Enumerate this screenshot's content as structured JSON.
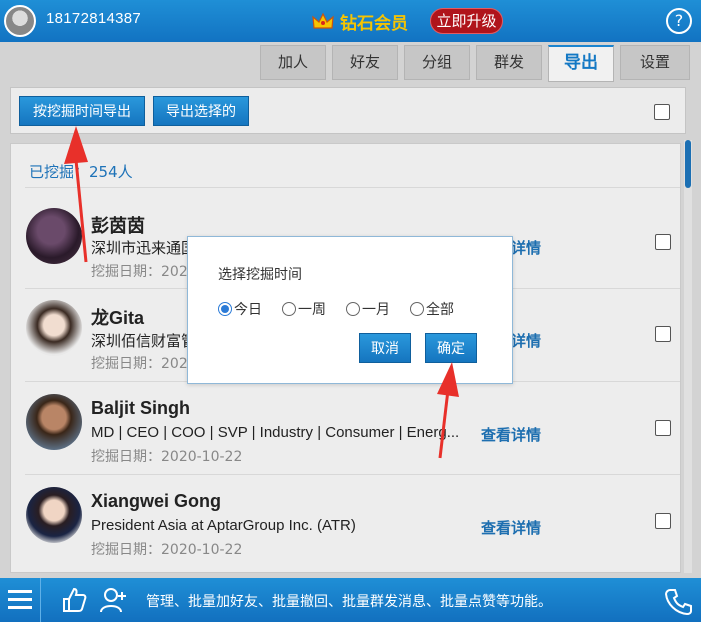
{
  "header": {
    "phone": "18172814387",
    "vip_label": "钻石会员",
    "upgrade_label": "立即升级",
    "help_label": "?"
  },
  "tabs": [
    {
      "label": "加人",
      "active": false
    },
    {
      "label": "好友",
      "active": false
    },
    {
      "label": "分组",
      "active": false
    },
    {
      "label": "群发",
      "active": false
    },
    {
      "label": "导出",
      "active": true
    },
    {
      "label": "设置",
      "active": false
    }
  ],
  "toolbar": {
    "export_by_time_label": "按挖掘时间导出",
    "export_selected_label": "导出选择的"
  },
  "list": {
    "count_label": "已挖掘：254人",
    "items": [
      {
        "name": "彭茵茵",
        "desc": "深圳市迅来通国",
        "date": "挖掘日期：202",
        "detail": "详情"
      },
      {
        "name": "龙Gita",
        "desc": "深圳佰信财富管",
        "date": "挖掘日期：202",
        "detail": "详情"
      },
      {
        "name": "Baljit Singh",
        "desc": "MD | CEO | COO | SVP | Industry | Consumer | Energ...",
        "date": "挖掘日期：2020-10-22",
        "detail": "查看详情"
      },
      {
        "name": "Xiangwei Gong",
        "desc": "President Asia at AptarGroup Inc. (ATR)",
        "date": "挖掘日期：2020-10-22",
        "detail": "查看详情"
      }
    ]
  },
  "dialog": {
    "title": "选择挖掘时间",
    "options": [
      {
        "label": "今日",
        "selected": true
      },
      {
        "label": "一周",
        "selected": false
      },
      {
        "label": "一月",
        "selected": false
      },
      {
        "label": "全部",
        "selected": false
      }
    ],
    "cancel_label": "取消",
    "confirm_label": "确定"
  },
  "bottom": {
    "marquee_text": "管理、批量加好友、批量撤回、批量群发消息、批量点赞等功能。"
  },
  "colors": {
    "brand_blue": "#1b84cf",
    "gold": "#f6c400",
    "upgrade_red": "#b0141b",
    "annotation_red": "#e8302a"
  }
}
